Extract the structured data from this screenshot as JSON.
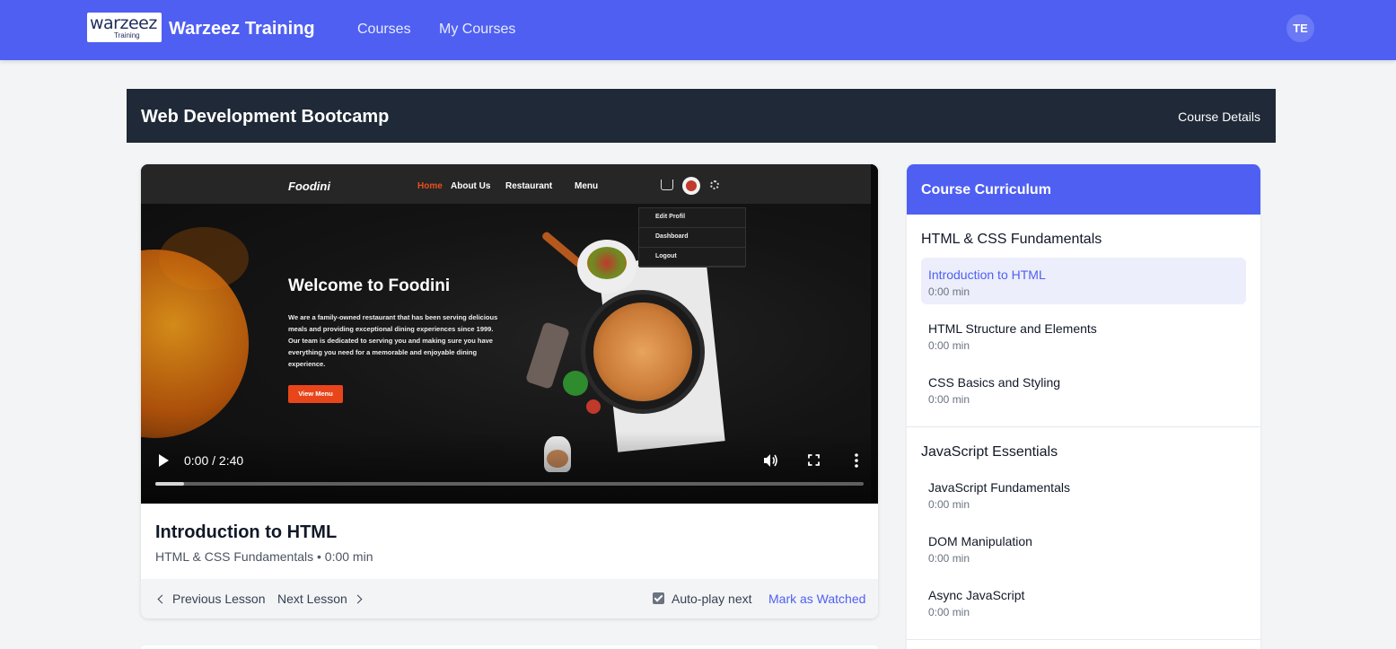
{
  "header": {
    "logo_text": "warzeez",
    "logo_subtext": "Training",
    "brand": "Warzeez Training",
    "nav": [
      "Courses",
      "My Courses"
    ],
    "avatar_initials": "TE",
    "color": "#4f5ff2"
  },
  "course": {
    "title": "Web Development Bootcamp",
    "details_link": "Course Details"
  },
  "video": {
    "site_logo": "Foodini",
    "site_nav": [
      "Home",
      "About Us",
      "Restaurant",
      "Menu"
    ],
    "dropdown": [
      "Edit Profil",
      "Dashboard",
      "Logout"
    ],
    "hero_title": "Welcome to Foodini",
    "hero_text": "We are a family-owned restaurant that has been serving delicious meals and providing exceptional dining experiences since 1999. Our team is dedicated to serving you and making sure you have everything you need for a memorable and enjoyable dining experience.",
    "hero_button": "View Menu",
    "time_display": "0:00 / 2:40",
    "progress": 0.04
  },
  "lesson": {
    "title": "Introduction to HTML",
    "meta": "HTML & CSS Fundamentals • 0:00 min",
    "prev_label": "Previous Lesson",
    "next_label": "Next Lesson",
    "autoplay_label": "Auto-play next",
    "autoplay_checked": true,
    "mark_watched_label": "Mark as Watched"
  },
  "curriculum": {
    "title": "Course Curriculum",
    "sections": [
      {
        "title": "HTML & CSS Fundamentals",
        "lessons": [
          {
            "title": "Introduction to HTML",
            "duration": "0:00 min",
            "active": true
          },
          {
            "title": "HTML Structure and Elements",
            "duration": "0:00 min",
            "active": false
          },
          {
            "title": "CSS Basics and Styling",
            "duration": "0:00 min",
            "active": false
          }
        ]
      },
      {
        "title": "JavaScript Essentials",
        "lessons": [
          {
            "title": "JavaScript Fundamentals",
            "duration": "0:00 min",
            "active": false
          },
          {
            "title": "DOM Manipulation",
            "duration": "0:00 min",
            "active": false
          },
          {
            "title": "Async JavaScript",
            "duration": "0:00 min",
            "active": false
          }
        ]
      }
    ]
  }
}
